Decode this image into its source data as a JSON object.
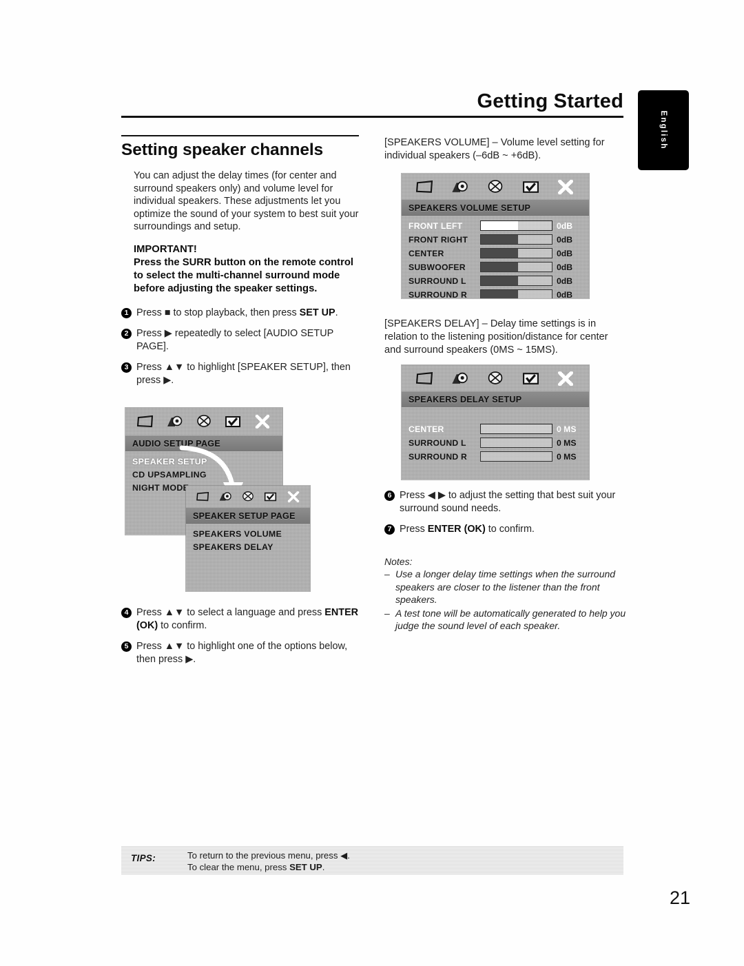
{
  "header": {
    "title": "Getting Started",
    "language_tab": "English"
  },
  "left_column": {
    "section_title": "Setting speaker channels",
    "intro": "You can adjust the delay times (for center and surround speakers only) and volume level for individual speakers. These adjustments let you optimize the sound of your system to best suit your surroundings and setup.",
    "important_heading": "IMPORTANT!",
    "important_body": "Press the SURR button on the remote control to select the multi-channel surround mode before adjusting the speaker settings.",
    "steps": [
      {
        "num": "1",
        "html": "Press ■ to stop playback, then press <b>SET UP</b>."
      },
      {
        "num": "2",
        "html": "Press ▶ repeatedly to select [AUDIO SETUP PAGE]."
      },
      {
        "num": "3",
        "html": "Press ▲▼ to highlight [SPEAKER SETUP], then press ▶."
      },
      {
        "num": "4",
        "html": "Press ▲▼ to select a language and press <b>ENTER (OK)</b> to confirm."
      },
      {
        "num": "5",
        "html": "Press ▲▼ to highlight one of the options below, then press ▶."
      }
    ]
  },
  "right_column": {
    "speakers_volume_para": "[SPEAKERS VOLUME] – Volume level setting for individual speakers (–6dB ~ +6dB).",
    "speakers_delay_para": "[SPEAKERS DELAY] – Delay time settings is in relation to the listening position/distance for center and surround speakers (0MS ~ 15MS).",
    "steps": [
      {
        "num": "6",
        "html": "Press ◀ ▶ to adjust the setting that best suit your surround sound needs."
      },
      {
        "num": "7",
        "html": "Press <b>ENTER (OK)</b> to confirm."
      }
    ],
    "notes_label": "Notes:",
    "notes": [
      "Use a longer delay time settings when the surround speakers are closer to the listener than the front speakers.",
      "A test tone will be automatically generated to help you judge the sound level of each speaker."
    ]
  },
  "osd_screens": {
    "audio_setup": {
      "title": "AUDIO SETUP PAGE",
      "icons": [
        "tv-screen-icon",
        "audio-speaker-icon",
        "film-reel-icon",
        "preference-checkbox-icon",
        "close-x-icon"
      ],
      "items": [
        {
          "label": "SPEAKER SETUP",
          "selected": true
        },
        {
          "label": "CD UPSAMPLING",
          "selected": false
        },
        {
          "label": "NIGHT MODE",
          "selected": false
        }
      ]
    },
    "speaker_setup": {
      "title": "SPEAKER SETUP PAGE",
      "icons": [
        "tv-screen-icon",
        "audio-speaker-icon",
        "film-reel-icon",
        "preference-checkbox-icon",
        "close-x-icon"
      ],
      "items": [
        {
          "label": "SPEAKERS VOLUME",
          "selected": false
        },
        {
          "label": "SPEAKERS DELAY",
          "selected": false
        }
      ]
    },
    "speakers_volume": {
      "title": "SPEAKERS VOLUME SETUP",
      "icons": [
        "tv-screen-icon",
        "audio-speaker-icon",
        "film-reel-icon",
        "preference-checkbox-icon",
        "close-x-icon"
      ],
      "rows": [
        {
          "label": "FRONT LEFT",
          "value": "0dB",
          "fill_percent": 52,
          "selected": true
        },
        {
          "label": "FRONT RIGHT",
          "value": "0dB",
          "fill_percent": 52,
          "selected": false
        },
        {
          "label": "CENTER",
          "value": "0dB",
          "fill_percent": 52,
          "selected": false
        },
        {
          "label": "SUBWOOFER",
          "value": "0dB",
          "fill_percent": 52,
          "selected": false
        },
        {
          "label": "SURROUND L",
          "value": "0dB",
          "fill_percent": 52,
          "selected": false
        },
        {
          "label": "SURROUND R",
          "value": "0dB",
          "fill_percent": 52,
          "selected": false
        }
      ]
    },
    "speakers_delay": {
      "title": "SPEAKERS DELAY SETUP",
      "icons": [
        "tv-screen-icon",
        "audio-speaker-icon",
        "film-reel-icon",
        "preference-checkbox-icon",
        "close-x-icon"
      ],
      "rows": [
        {
          "label": "CENTER",
          "value": "0 MS",
          "fill_percent": 0,
          "selected": true
        },
        {
          "label": "SURROUND L",
          "value": "0 MS",
          "fill_percent": 0,
          "selected": false
        },
        {
          "label": "SURROUND R",
          "value": "0 MS",
          "fill_percent": 0,
          "selected": false
        }
      ]
    }
  },
  "footer": {
    "tips_label": "TIPS:",
    "tips_line1": "To return to the previous menu, press ◀.",
    "tips_line2_prefix": "To clear the menu, press ",
    "tips_line2_bold": "SET UP",
    "tips_line2_suffix": ".",
    "page_number": "21"
  }
}
